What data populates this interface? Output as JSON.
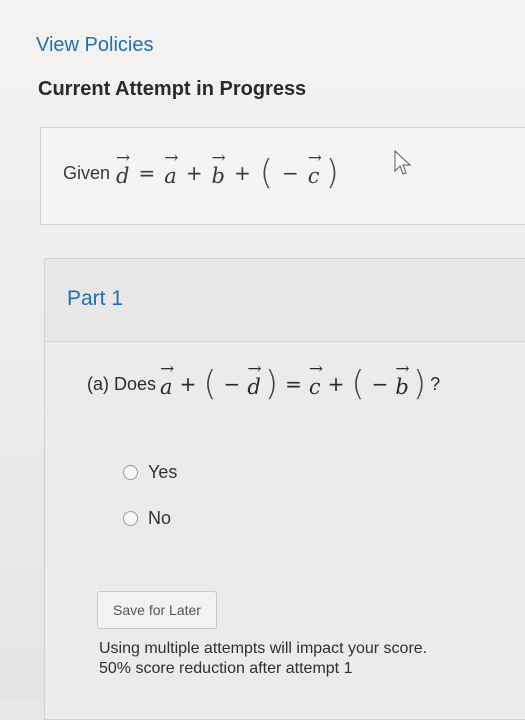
{
  "header": {
    "view_policies": "View Policies",
    "attempt_title": "Current Attempt in Progress"
  },
  "given": {
    "label": "Given",
    "d": "d",
    "a": "a",
    "b": "b",
    "c": "c",
    "eq": "=",
    "plus": "+",
    "minus": "−"
  },
  "part": {
    "title": "Part 1",
    "question_prefix": "(a) Does",
    "qmark": "?",
    "options": [
      "Yes",
      "No"
    ]
  },
  "actions": {
    "save_later": "Save for Later"
  },
  "notice": {
    "line1": "Using multiple attempts will impact your score.",
    "line2": "50% score reduction after attempt 1"
  }
}
